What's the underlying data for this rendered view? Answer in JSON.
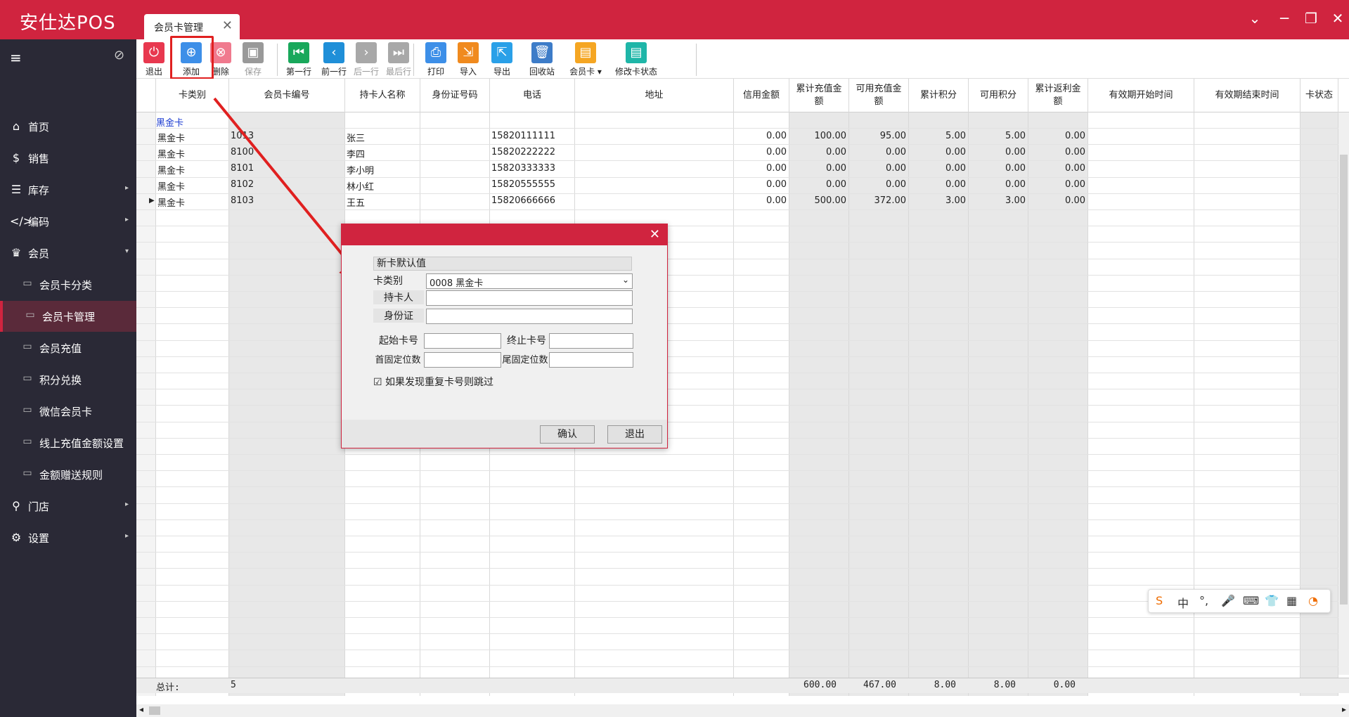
{
  "app": {
    "title": "安仕达POS"
  },
  "tab": {
    "label": "会员卡管理",
    "close": "✕"
  },
  "window_controls": {
    "minimize": "⌄",
    "maximize": "─",
    "restore": "❐",
    "close": "✕"
  },
  "sidebar": {
    "items": [
      {
        "label": "首页",
        "icon": "home-icon",
        "glyph": "⌂"
      },
      {
        "label": "销售",
        "icon": "currency-icon",
        "glyph": "$"
      },
      {
        "label": "库存",
        "icon": "inventory-icon",
        "glyph": "☰",
        "arrow": "▸"
      },
      {
        "label": "编码",
        "icon": "code-icon",
        "glyph": "</>",
        "arrow": "▸"
      },
      {
        "label": "会员",
        "icon": "crown-icon",
        "glyph": "♛",
        "arrow": "▾"
      },
      {
        "label": "会员卡分类",
        "icon": "window-icon",
        "glyph": "▭",
        "sub": true
      },
      {
        "label": "会员卡管理",
        "icon": "window-icon",
        "glyph": "▭",
        "sub": true,
        "active": true
      },
      {
        "label": "会员充值",
        "icon": "window-icon",
        "glyph": "▭",
        "sub": true
      },
      {
        "label": "积分兑换",
        "icon": "window-icon",
        "glyph": "▭",
        "sub": true
      },
      {
        "label": "微信会员卡",
        "icon": "window-icon",
        "glyph": "▭",
        "sub": true
      },
      {
        "label": "线上充值金额设置",
        "icon": "window-icon",
        "glyph": "▭",
        "sub": true
      },
      {
        "label": "金额赠送规则",
        "icon": "window-icon",
        "glyph": "▭",
        "sub": true
      },
      {
        "label": "门店",
        "icon": "search-icon",
        "glyph": "⚲",
        "arrow": "▸"
      },
      {
        "label": "设置",
        "icon": "gear-icon",
        "glyph": "⚙",
        "arrow": "▸"
      }
    ]
  },
  "toolbar": {
    "buttons": [
      {
        "label": "退出",
        "icon": "power-icon",
        "glyph": "⏻",
        "color": "#e8384f"
      },
      {
        "label": "添加",
        "icon": "add-icon",
        "glyph": "⊕",
        "color": "#3d8fe8"
      },
      {
        "label": "删除",
        "icon": "delete-icon",
        "glyph": "⊗",
        "color": "#f07a8e"
      },
      {
        "label": "保存",
        "icon": "save-icon",
        "glyph": "▣",
        "color": "#999999",
        "disabled": true
      },
      {
        "label": "第一行",
        "icon": "first-row-icon",
        "glyph": "⏮",
        "color": "#19a85b"
      },
      {
        "label": "前一行",
        "icon": "prev-row-icon",
        "glyph": "‹",
        "color": "#1f8fd8"
      },
      {
        "label": "后一行",
        "icon": "next-row-icon",
        "glyph": "›",
        "color": "#a8a8a8",
        "disabled": true
      },
      {
        "label": "最后行",
        "icon": "last-row-icon",
        "glyph": "⏭",
        "color": "#a8a8a8",
        "disabled": true
      },
      {
        "label": "打印",
        "icon": "print-icon",
        "glyph": "⎙",
        "color": "#3d8fe8"
      },
      {
        "label": "导入",
        "icon": "import-icon",
        "glyph": "⇲",
        "color": "#f08a1e"
      },
      {
        "label": "导出",
        "icon": "export-icon",
        "glyph": "⇱",
        "color": "#2aa0e8"
      },
      {
        "label": "回收站",
        "icon": "recycle-bin-icon",
        "glyph": "🗑",
        "color": "#3d7cc8"
      },
      {
        "label": "会员卡 ▾",
        "icon": "member-card-icon",
        "glyph": "▤",
        "color": "#f5a623"
      },
      {
        "label": "修改卡状态",
        "icon": "card-status-icon",
        "glyph": "▤",
        "color": "#1fb6a8"
      }
    ]
  },
  "grid": {
    "headers": [
      "卡类别",
      "会员卡编号",
      "持卡人名称",
      "身份证号码",
      "电话",
      "地址",
      "信用金额",
      "累计充值金额",
      "可用充值金额",
      "累计积分",
      "可用积分",
      "累计返利金额",
      "有效期开始时间",
      "有效期结束时间",
      "卡状态"
    ],
    "group_label": "黑金卡",
    "rows": [
      [
        "黑金卡",
        "1013",
        "张三",
        "",
        "15820111111",
        "",
        "0.00",
        "100.00",
        "95.00",
        "5.00",
        "5.00",
        "0.00"
      ],
      [
        "黑金卡",
        "8100",
        "李四",
        "",
        "15820222222",
        "",
        "0.00",
        "0.00",
        "0.00",
        "0.00",
        "0.00",
        "0.00"
      ],
      [
        "黑金卡",
        "8101",
        "李小明",
        "",
        "15820333333",
        "",
        "0.00",
        "0.00",
        "0.00",
        "0.00",
        "0.00",
        "0.00"
      ],
      [
        "黑金卡",
        "8102",
        "林小红",
        "",
        "15820555555",
        "",
        "0.00",
        "0.00",
        "0.00",
        "0.00",
        "0.00",
        "0.00"
      ],
      [
        "黑金卡",
        "8103",
        "王五",
        "",
        "15820666666",
        "",
        "0.00",
        "500.00",
        "372.00",
        "3.00",
        "3.00",
        "0.00"
      ]
    ],
    "current_row_marker": "▶",
    "totals": {
      "label": "总计:",
      "count": "5",
      "recharge_total": "600.00",
      "available_recharge": "467.00",
      "points_total": "8.00",
      "points_available": "8.00",
      "rebate_total": "0.00"
    }
  },
  "dialog": {
    "close": "✕",
    "section_title": "新卡默认值",
    "card_type_label": "卡类别",
    "card_type_value": "0008  黑金卡",
    "holder_label": "持卡人",
    "holder_value": "",
    "id_label": "身份证",
    "id_value": "",
    "start_no_label": "起始卡号",
    "start_no_value": "",
    "end_no_label": "终止卡号",
    "end_no_value": "",
    "prefix_label": "首固定位数",
    "prefix_value": "",
    "suffix_label": "尾固定位数",
    "suffix_value": "",
    "skip_dup_label": "如果发现重复卡号则跳过",
    "skip_dup_checked": true,
    "confirm": "确认",
    "exit": "退出"
  },
  "ime": {
    "items": [
      {
        "icon": "sogou-icon",
        "glyph": "S",
        "color": "#ef6c00"
      },
      {
        "icon": "chinese-mode-icon",
        "glyph": "中",
        "color": "#333333"
      },
      {
        "icon": "punctuation-icon",
        "glyph": "°,",
        "color": "#333333"
      },
      {
        "icon": "microphone-icon",
        "glyph": "🎤",
        "color": "#333333"
      },
      {
        "icon": "keyboard-icon",
        "glyph": "⌨",
        "color": "#333333"
      },
      {
        "icon": "skin-icon",
        "glyph": "👕",
        "color": "#ef6c00"
      },
      {
        "icon": "toolbox-icon",
        "glyph": "▦",
        "color": "#333333"
      },
      {
        "icon": "mascot-icon",
        "glyph": "◔",
        "color": "#ef6c00"
      }
    ]
  },
  "colors": {
    "brand": "#d0243f",
    "sidebar_bg": "#2a2936",
    "annotation_red": "#e02020",
    "link_blue": "#1a3ad0"
  }
}
